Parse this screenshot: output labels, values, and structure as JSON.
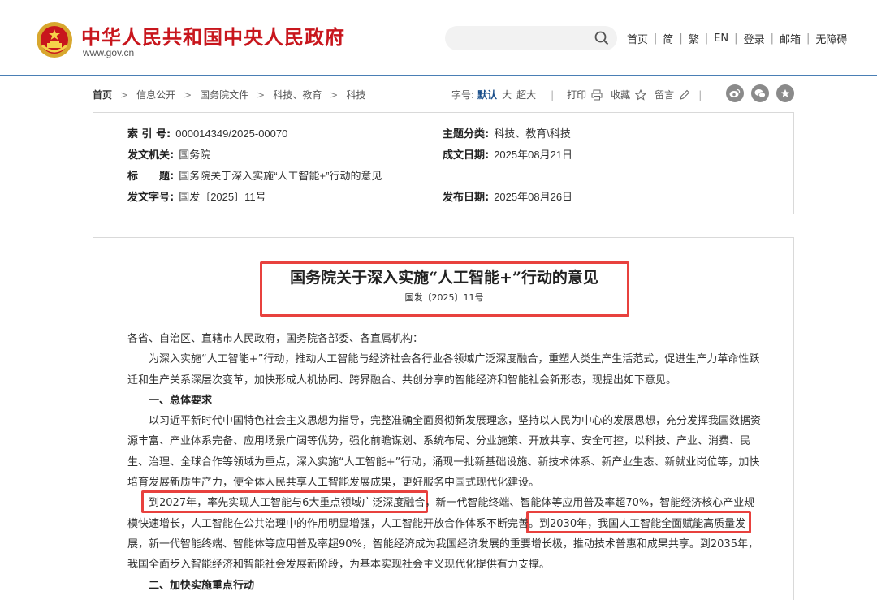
{
  "header": {
    "site_title": "中华人民共和国中央人民政府",
    "site_domain": "www.gov.cn",
    "search_placeholder": "",
    "links": [
      "首页",
      "简",
      "繁",
      "EN",
      "登录",
      "邮箱",
      "无障碍"
    ]
  },
  "breadcrumb": {
    "items": [
      "首页",
      "信息公开",
      "国务院文件",
      "科技、教育",
      "科技"
    ]
  },
  "toolbar": {
    "font_label": "字号:",
    "font_default": "默认",
    "font_large": "大",
    "font_xlarge": "超大",
    "print": "打印",
    "favorite": "收藏",
    "comment": "留言"
  },
  "meta": {
    "index_label": "索 引 号:",
    "index_value": "000014349/2025-00070",
    "topic_label": "主题分类:",
    "topic_value": "科技、教育\\科技",
    "issuer_label": "发文机关:",
    "issuer_value": "国务院",
    "written_label": "成文日期:",
    "written_value": "2025年08月21日",
    "title_label": "标　　题:",
    "title_value": "国务院关于深入实施“人工智能+”行动的意见",
    "docno_label": "发文字号:",
    "docno_value": "国发〔2025〕11号",
    "published_label": "发布日期:",
    "published_value": "2025年08月26日"
  },
  "article": {
    "title": "国务院关于深入实施“人工智能+”行动的意见",
    "doc_no": "国发〔2025〕11号",
    "addressee": "各省、自治区、直辖市人民政府，国务院各部委、各直属机构：",
    "intro": "为深入实施“人工智能+”行动，推动人工智能与经济社会各行业各领域广泛深度融合，重塑人类生产生活范式，促进生产力革命性跃迁和生产关系深层次变革，加快形成人机协同、跨界融合、共创分享的智能经济和智能社会新形态，现提出如下意见。",
    "section1_title": "一、总体要求",
    "section1_para1": "以习近平新时代中国特色社会主义思想为指导，完整准确全面贯彻新发展理念，坚持以人民为中心的发展思想，充分发挥我国数据资源丰富、产业体系完备、应用场景广阔等优势，强化前瞻谋划、系统布局、分业施策、开放共享、安全可控，以科技、产业、消费、民生、治理、全球合作等领域为重点，深入实施“人工智能+”行动，涌现一批新基础设施、新技术体系、新产业生态、新就业岗位等，加快培育发展新质生产力，使全体人民共享人工智能发展成果，更好服务中国式现代化建设。",
    "section1_para2": "到2027年，率先实现人工智能与6大重点领域广泛深度融合，新一代智能终端、智能体等应用普及率超70%，智能经济核心产业规模快速增长，人工智能在公共治理中的作用明显增强，人工智能开放合作体系不断完善。到2030年，我国人工智能全面赋能高质量发展，新一代智能终端、智能体等应用普及率超90%，智能经济成为我国经济发展的重要增长极，推动技术普惠和成果共享。到2035年，我国全面步入智能经济和智能社会发展新阶段，为基本实现社会主义现代化提供有力支撑。",
    "section2_title": "二、加快实施重点行动"
  },
  "colors": {
    "brand_red": "#c8161d",
    "highlight_box": "#e8413e",
    "nav_blue": "#1a4f8b"
  }
}
